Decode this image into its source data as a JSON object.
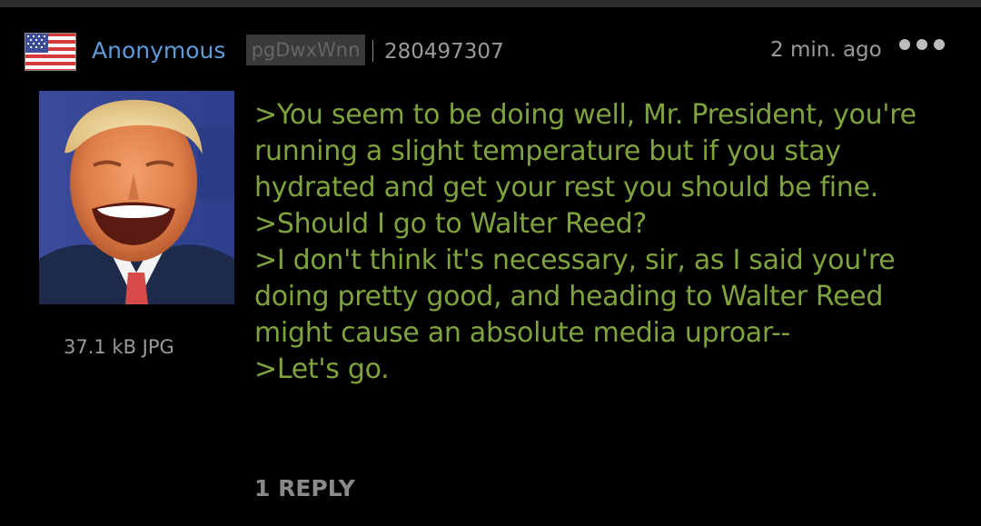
{
  "post": {
    "name": "Anonymous",
    "poster_id": "pgDwxWnn",
    "post_number": "280497307",
    "timestamp": "2 min. ago",
    "flag_icon": "us-flag-icon",
    "menu_icon": "more-dots-icon",
    "file_info": "37.1 kB JPG",
    "comment_lines": [
      ">You seem to be doing well, Mr. President, you're",
      "running a slight temperature but if you stay",
      "hydrated and get your rest you should be fine.",
      ">Should I go to Walter Reed?",
      ">I don't think it's necessary, sir, as I said you're",
      "doing pretty good, and heading to Walter Reed",
      "might cause an absolute media uproar--",
      ">Let's go."
    ],
    "replies_label": "1 REPLY"
  },
  "colors": {
    "background": "#000000",
    "name": "#5e9bd8",
    "greentext": "#7fa33d",
    "meta": "#9a9a9a"
  }
}
